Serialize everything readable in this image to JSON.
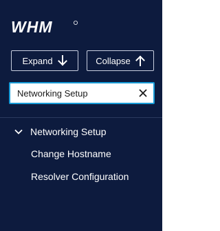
{
  "brand": {
    "logo_text": "WHM"
  },
  "toolbar": {
    "expand_label": "Expand",
    "collapse_label": "Collapse"
  },
  "search": {
    "value": "Networking Setup"
  },
  "nav": {
    "group_label": "Networking Setup",
    "items": [
      {
        "label": "Change Hostname"
      },
      {
        "label": "Resolver Configuration"
      }
    ]
  },
  "icons": {
    "expand": "arrow-down-icon",
    "collapse": "arrow-up-icon",
    "clear": "close-icon",
    "group": "chevron-down-icon"
  },
  "colors": {
    "sidebar_bg": "#0d1b3e",
    "search_border": "#179bd7",
    "text": "#ffffff"
  }
}
